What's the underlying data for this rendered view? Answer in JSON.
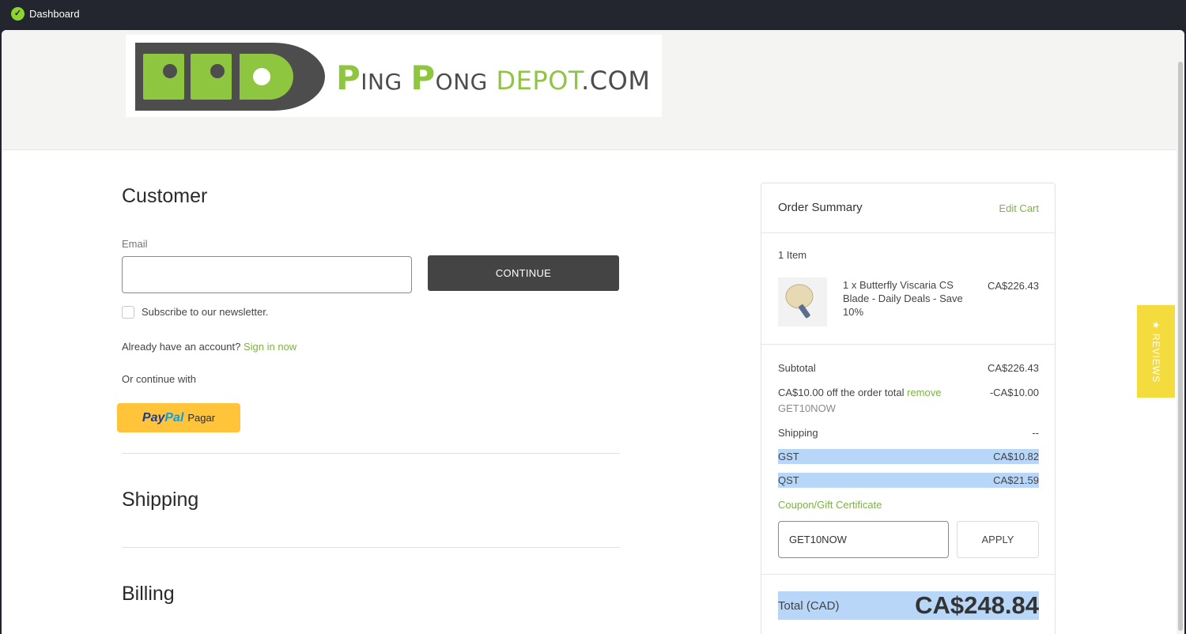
{
  "window": {
    "title": "Dashboard"
  },
  "logo": {
    "mark": "PPD",
    "word_p1": "P",
    "word_ing": "ING",
    "word_p2": "P",
    "word_ong": "ONG",
    "word_depot": "DEPOT",
    "word_com": ".COM"
  },
  "customer": {
    "title": "Customer",
    "email_label": "Email",
    "email_value": "",
    "continue_label": "CONTINUE",
    "newsletter_label": "Subscribe to our newsletter.",
    "account_prompt": "Already have an account?",
    "sign_in_label": "Sign in now",
    "or_continue": "Or continue with",
    "paypal": {
      "pay": "Pay",
      "pal": "Pal",
      "action": "Pagar"
    }
  },
  "shipping": {
    "title": "Shipping"
  },
  "billing": {
    "title": "Billing"
  },
  "order_summary": {
    "title": "Order Summary",
    "edit_cart": "Edit Cart",
    "item_count": "1 Item",
    "items": [
      {
        "description": "1 x Butterfly Viscaria CS Blade - Daily Deals - Save 10%",
        "price": "CA$226.43"
      }
    ],
    "subtotal_label": "Subtotal",
    "subtotal_value": "CA$226.43",
    "discount_label": "CA$10.00 off the order total",
    "discount_remove": "remove",
    "discount_value": "-CA$10.00",
    "discount_code": "GET10NOW",
    "shipping_label": "Shipping",
    "shipping_value": "--",
    "gst_label": "GST",
    "gst_value": "CA$10.82",
    "qst_label": "QST",
    "qst_value": "CA$21.59",
    "coupon_label": "Coupon/Gift Certificate",
    "coupon_value": "GET10NOW",
    "apply_label": "APPLY",
    "total_label": "Total (CAD)",
    "total_value": "CA$248.84"
  },
  "reviews_tab": {
    "label": "★ REVIEWS"
  },
  "colors": {
    "accent_green": "#7cb342",
    "brand_green": "#8ec63f",
    "paypal_yellow": "#ffc439",
    "reviews_yellow": "#f4dc3e",
    "highlight": "#b8d6f8"
  }
}
